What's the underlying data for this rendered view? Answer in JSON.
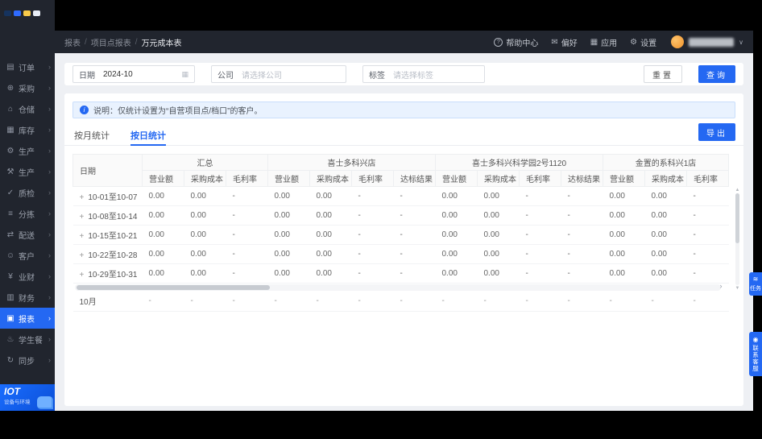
{
  "colors": {
    "primary": "#2468f2",
    "sidebar_bg": "#21252e",
    "content_bg": "#eef0f4",
    "alert_bg": "#e9f2fe"
  },
  "sidebar": {
    "logo_colors": [
      "#16335e",
      "#2f6bff",
      "#f6c94a",
      "#e9eef6"
    ],
    "items": [
      {
        "icon": "▤",
        "label": "订单"
      },
      {
        "icon": "⊕",
        "label": "采购"
      },
      {
        "icon": "⌂",
        "label": "仓储"
      },
      {
        "icon": "▦",
        "label": "库存"
      },
      {
        "icon": "⚙",
        "label": "生产"
      },
      {
        "icon": "⚒",
        "label": "生产"
      },
      {
        "icon": "✓",
        "label": "质检"
      },
      {
        "icon": "≡",
        "label": "分拣"
      },
      {
        "icon": "⇄",
        "label": "配送"
      },
      {
        "icon": "☺",
        "label": "客户"
      },
      {
        "icon": "¥",
        "label": "业财"
      },
      {
        "icon": "▥",
        "label": "财务"
      },
      {
        "icon": "▣",
        "label": "报表",
        "active": true
      },
      {
        "icon": "♨",
        "label": "学生餐"
      },
      {
        "icon": "↻",
        "label": "同步"
      }
    ],
    "iot": {
      "title": "IOT",
      "subtitle": "设备与环境"
    }
  },
  "topbar": {
    "breadcrumb": [
      "报表",
      "项目点报表",
      "万元成本表"
    ],
    "actions": [
      {
        "icon": "?",
        "label": "帮助中心",
        "name": "help-center"
      },
      {
        "icon": "✉",
        "label": "偏好",
        "name": "preferences"
      },
      {
        "icon": "▦",
        "label": "应用",
        "name": "apps"
      },
      {
        "icon": "⚙",
        "label": "设置",
        "name": "settings"
      }
    ],
    "user_chevron": "∨"
  },
  "filters": {
    "date": {
      "label": "日期",
      "value": "2024-10",
      "icon": "▦"
    },
    "company": {
      "label": "公司",
      "placeholder": "请选择公司"
    },
    "tag": {
      "label": "标签",
      "placeholder": "请选择标签"
    },
    "reset_label": "重置",
    "search_label": "查询"
  },
  "alert": {
    "icon": "i",
    "text": "说明：仅统计设置为“自营项目点/档口”的客户。"
  },
  "tabs": [
    {
      "label": "按月统计",
      "active": false
    },
    {
      "label": "按日统计",
      "active": true
    }
  ],
  "export_label": "导出",
  "table": {
    "date_header": "日期",
    "groups": [
      {
        "name": "汇总",
        "cols": [
          "营业额",
          "采购成本",
          "毛利率"
        ]
      },
      {
        "name": "喜士多科兴店",
        "cols": [
          "营业额",
          "采购成本",
          "毛利率",
          "达标结果"
        ]
      },
      {
        "name": "喜士多科兴科学园2号1120",
        "cols": [
          "营业额",
          "采购成本",
          "毛利率",
          "达标结果"
        ]
      },
      {
        "name": "金置的系科兴1店",
        "cols": [
          "营业额",
          "采购成本",
          "毛利率"
        ]
      }
    ],
    "rows": [
      {
        "label": "10-01至10-07",
        "values": [
          "0.00",
          "0.00",
          "-",
          "0.00",
          "0.00",
          "-",
          "-",
          "0.00",
          "0.00",
          "-",
          "-",
          "0.00",
          "0.00",
          "-"
        ]
      },
      {
        "label": "10-08至10-14",
        "values": [
          "0.00",
          "0.00",
          "-",
          "0.00",
          "0.00",
          "-",
          "-",
          "0.00",
          "0.00",
          "-",
          "-",
          "0.00",
          "0.00",
          "-"
        ]
      },
      {
        "label": "10-15至10-21",
        "values": [
          "0.00",
          "0.00",
          "-",
          "0.00",
          "0.00",
          "-",
          "-",
          "0.00",
          "0.00",
          "-",
          "-",
          "0.00",
          "0.00",
          "-"
        ]
      },
      {
        "label": "10-22至10-28",
        "values": [
          "0.00",
          "0.00",
          "-",
          "0.00",
          "0.00",
          "-",
          "-",
          "0.00",
          "0.00",
          "-",
          "-",
          "0.00",
          "0.00",
          "-"
        ]
      },
      {
        "label": "10-29至10-31",
        "values": [
          "0.00",
          "0.00",
          "-",
          "0.00",
          "0.00",
          "-",
          "-",
          "0.00",
          "0.00",
          "-",
          "-",
          "0.00",
          "0.00",
          "-"
        ]
      }
    ],
    "summary": {
      "label": "10月",
      "values": [
        "-",
        "-",
        "-",
        "-",
        "-",
        "-",
        "-",
        "-",
        "-",
        "-",
        "-",
        "-",
        "-",
        "-"
      ]
    }
  },
  "side_widgets": [
    {
      "icon": "≋",
      "label": "任务"
    },
    {
      "icon": "◉",
      "label": "联系客服"
    }
  ]
}
